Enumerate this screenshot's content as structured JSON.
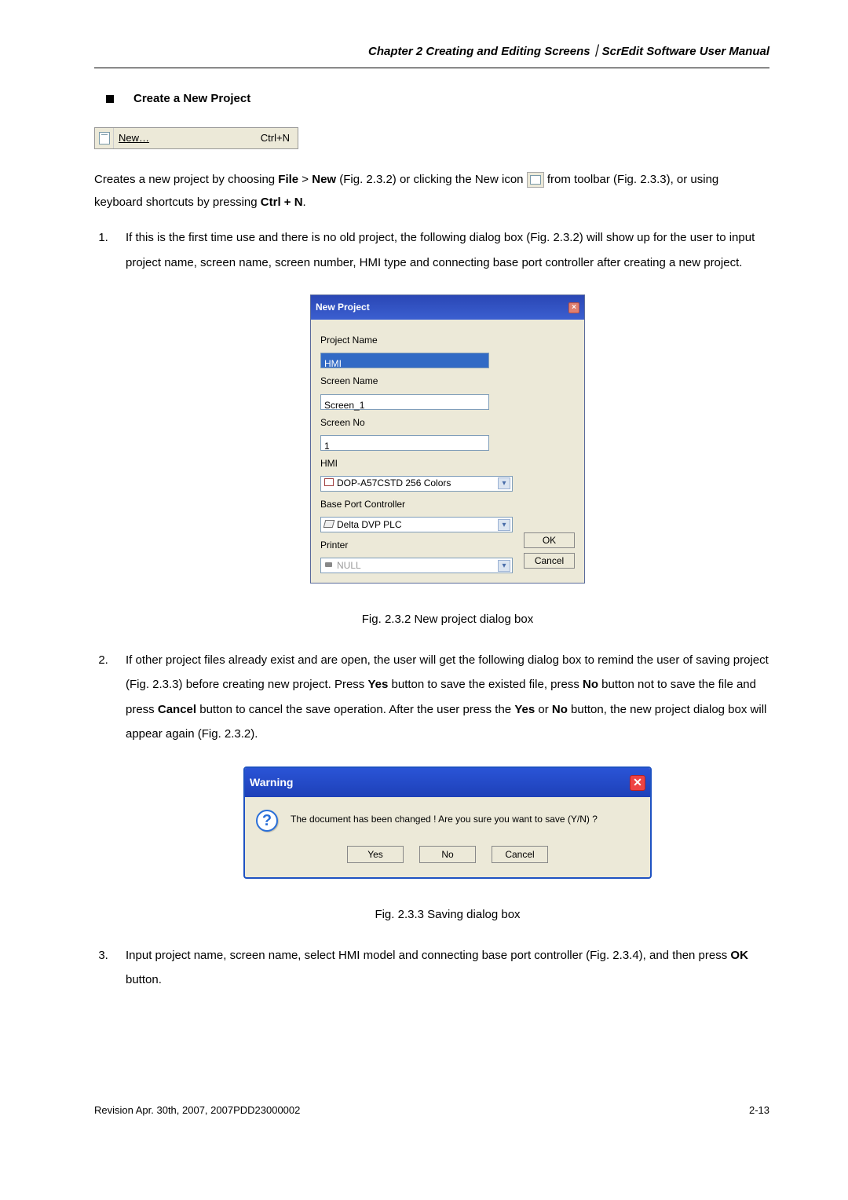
{
  "header": {
    "title": "Chapter 2  Creating and Editing Screens｜ScrEdit Software User Manual"
  },
  "section": {
    "title": "Create a New Project"
  },
  "menu_strip": {
    "item": "New…",
    "underline_letter": "N",
    "shortcut": "Ctrl+N"
  },
  "para1_parts": {
    "a": "Creates a new project by choosing ",
    "b": "File",
    "c": " > ",
    "d": "New",
    "e": " (Fig. 2.3.2) or clicking the New icon ",
    "f": " from toolbar (Fig. 2.3.3), or using keyboard shortcuts by pressing ",
    "g": "Ctrl + N",
    "h": "."
  },
  "list": {
    "item1": "If this is the first time use and there is no old project, the following dialog box (Fig. 2.3.2) will show up for the user to input project name, screen name, screen number, HMI type and connecting base port controller after creating a new project.",
    "item2_parts": {
      "a": "If other project files already exist and are open, the user will get the following dialog box to remind the user of saving project (Fig. 2.3.3) before creating new project. Press ",
      "yes": "Yes",
      "b": " button to save the existed file, press ",
      "no": "No",
      "c": " button not to save the file and press ",
      "cancel": "Cancel",
      "d": " button to cancel the save operation. After the user press the ",
      "yes2": "Yes",
      "e": " or ",
      "no2": "No",
      "f": " button, the new project dialog box will appear again (Fig. 2.3.2)."
    },
    "item3_parts": {
      "a": "Input project name, screen name, select HMI model and connecting base port controller (Fig. 2.3.4), and then press ",
      "ok": "OK",
      "b": " button."
    }
  },
  "new_project_dialog": {
    "title": "New Project",
    "labels": {
      "project_name": "Project Name",
      "screen_name": "Screen Name",
      "screen_no": "Screen No",
      "hmi": "HMI",
      "base_port": "Base Port Controller",
      "printer": "Printer"
    },
    "values": {
      "project_name": "HMI",
      "screen_name": "Screen_1",
      "screen_no": "1",
      "hmi": "DOP-A57CSTD 256 Colors",
      "base_port": "Delta DVP PLC",
      "printer": "NULL"
    },
    "buttons": {
      "ok": "OK",
      "cancel": "Cancel"
    }
  },
  "caption1": "Fig. 2.3.2 New project dialog box",
  "warning_dialog": {
    "title": "Warning",
    "message": "The document has been changed ! Are you sure you want to save (Y/N) ?",
    "buttons": {
      "yes": "Yes",
      "no": "No",
      "cancel": "Cancel"
    }
  },
  "caption2": "Fig. 2.3.3 Saving dialog box",
  "footer": {
    "left": "Revision Apr. 30th, 2007, 2007PDD23000002",
    "right": "2-13"
  }
}
